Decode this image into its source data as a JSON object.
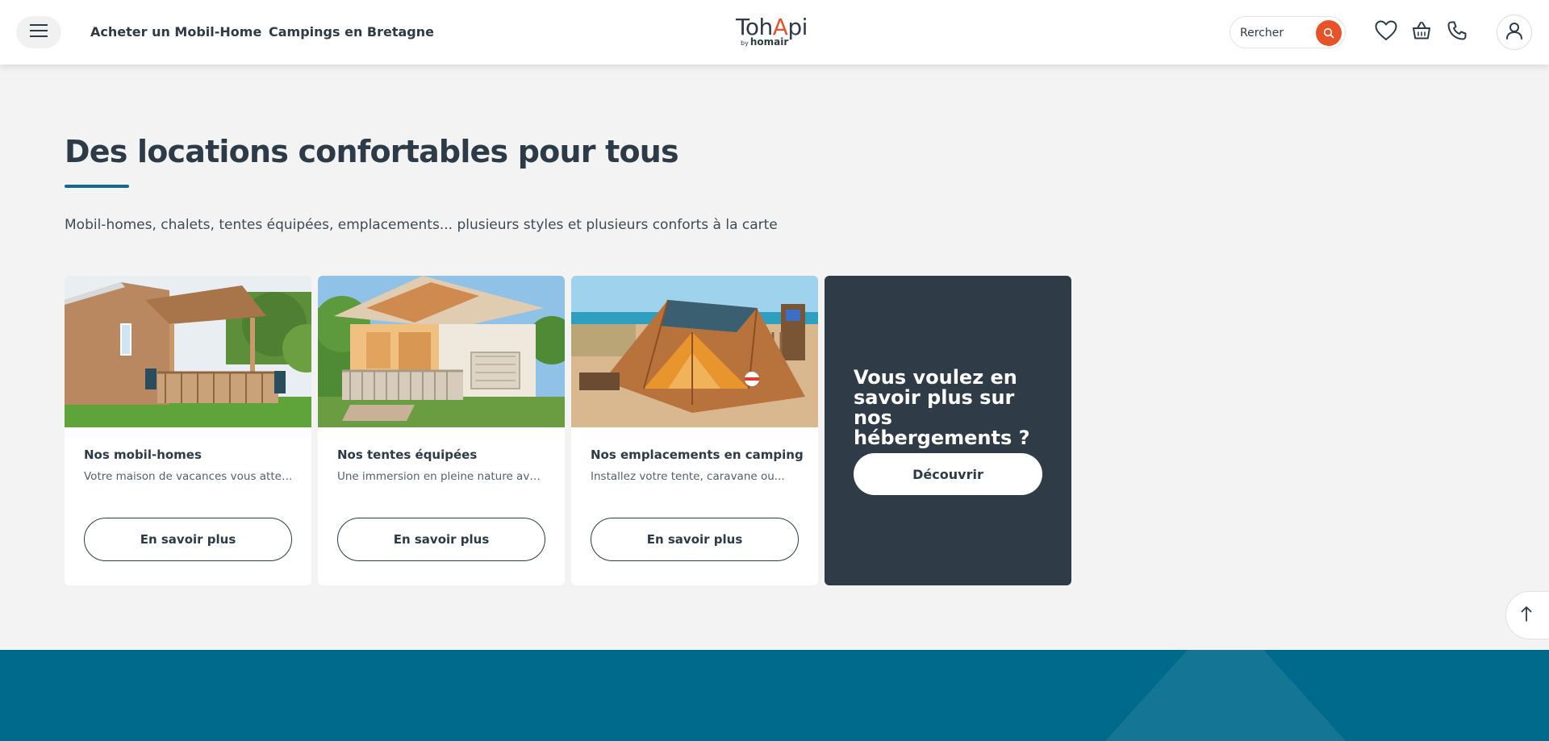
{
  "header": {
    "nav": [
      "Acheter un Mobil-Home",
      "Campings en Bretagne"
    ],
    "logo": {
      "prefix": "Toh",
      "accent": "A",
      "suffix": "pi",
      "by": "by",
      "brand": "homair"
    },
    "search_label": "Rercher"
  },
  "section": {
    "title": "Des locations confortables pour tous",
    "subtitle": "Mobil-homes, chalets, tentes équipées, emplacements... plusieurs styles et plusieurs conforts à la carte"
  },
  "cards": [
    {
      "title": "Nos mobil-homes",
      "description": "Votre maison de vacances vous atten...",
      "button": "En savoir plus"
    },
    {
      "title": "Nos tentes équipées",
      "description": "Une immersion en pleine nature avec...",
      "button": "En savoir plus"
    },
    {
      "title": "Nos emplacements en camping",
      "description": "Installez votre tente, caravane ou...",
      "button": "En savoir plus"
    }
  ],
  "promo": {
    "text": "Vous voulez en savoir plus sur nos hébergements ?",
    "button": "Découvrir"
  },
  "colors": {
    "brand_orange": "#e85228",
    "dark": "#2f3b47",
    "teal": "#006a8c",
    "underline": "#0f6a8e"
  },
  "icons": [
    "menu-icon",
    "search-icon",
    "heart-icon",
    "basket-icon",
    "phone-icon",
    "user-icon",
    "arrow-up-icon"
  ]
}
